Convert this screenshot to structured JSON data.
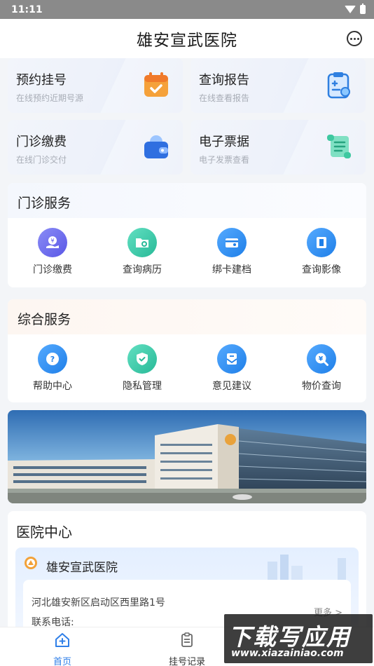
{
  "status_bar": {
    "time": "11:11"
  },
  "header": {
    "title": "雄安宣武医院"
  },
  "quick_cards": [
    {
      "title": "预约挂号",
      "subtitle": "在线预约近期号源",
      "icon": "calendar-icon"
    },
    {
      "title": "查询报告",
      "subtitle": "在线查看报告",
      "icon": "clipboard-report-icon"
    },
    {
      "title": "门诊缴费",
      "subtitle": "在线门诊交付",
      "icon": "wallet-icon"
    },
    {
      "title": "电子票据",
      "subtitle": "电子发票查看",
      "icon": "scroll-icon"
    }
  ],
  "outpatient": {
    "title": "门诊服务",
    "items": [
      {
        "label": "门诊缴费",
        "icon": "payment-hand-icon",
        "color": "#6f6ff0"
      },
      {
        "label": "查询病历",
        "icon": "folder-search-icon",
        "color": "#3ecfb0"
      },
      {
        "label": "绑卡建档",
        "icon": "card-icon",
        "color": "#2f8ff5"
      },
      {
        "label": "查询影像",
        "icon": "film-icon",
        "color": "#2f8ff5"
      }
    ]
  },
  "general": {
    "title": "综合服务",
    "items": [
      {
        "label": "帮助中心",
        "icon": "help-icon",
        "color": "#2f8ff5"
      },
      {
        "label": "隐私管理",
        "icon": "shield-check-icon",
        "color": "#3ecfb0"
      },
      {
        "label": "意见建议",
        "icon": "mail-feedback-icon",
        "color": "#2f8ff5"
      },
      {
        "label": "物价查询",
        "icon": "price-search-icon",
        "color": "#2f8ff5"
      }
    ]
  },
  "hospital_center": {
    "title": "医院中心",
    "hospital_name": "雄安宣武医院",
    "address": "河北雄安新区启动区西里路1号",
    "phone_label": "联系电话:",
    "more": "更多 >"
  },
  "tabbar": {
    "home": "首页",
    "records": "挂号记录"
  },
  "watermark": {
    "text": "下载写应用",
    "url": "www.xiazainiao.com"
  }
}
